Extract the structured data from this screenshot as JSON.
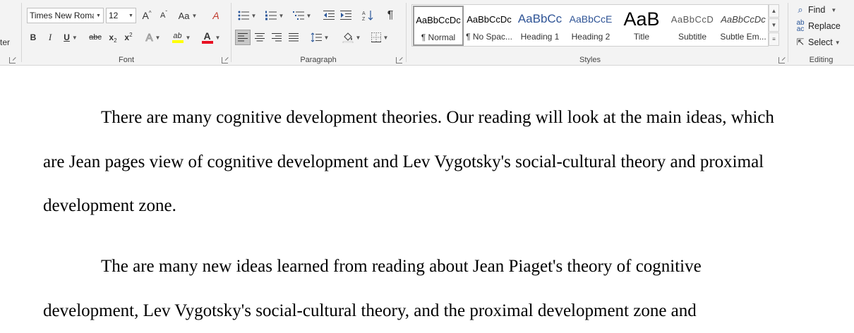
{
  "ribbon": {
    "clipboard": {
      "partial_label": "ter"
    },
    "font": {
      "label": "Font",
      "font_name": "Times New Roma",
      "font_size": "12",
      "grow_glyph": "A",
      "shrink_glyph": "A",
      "case_glyph": "Aa",
      "clear_glyph": "A",
      "bold_glyph": "B",
      "italic_glyph": "I",
      "underline_glyph": "U",
      "strike_glyph": "abc",
      "sub_glyph": "x",
      "sub_mark": "2",
      "sup_glyph": "x",
      "sup_mark": "2",
      "effects_glyph": "A",
      "highlight_glyph": "ab",
      "fontcolor_glyph": "A",
      "highlight_color": "#ffff00",
      "font_color": "#e81123"
    },
    "paragraph": {
      "label": "Paragraph",
      "pilcrow": "¶"
    },
    "styles": {
      "label": "Styles",
      "items": [
        {
          "sample": "AaBbCcDc",
          "name": "¶ Normal"
        },
        {
          "sample": "AaBbCcDc",
          "name": "¶ No Spac..."
        },
        {
          "sample": "AaBbCc",
          "name": "Heading 1"
        },
        {
          "sample": "AaBbCcE",
          "name": "Heading 2"
        },
        {
          "sample": "AaB",
          "name": "Title"
        },
        {
          "sample": "AaBbCcD",
          "name": "Subtitle"
        },
        {
          "sample": "AaBbCcDc",
          "name": "Subtle Em..."
        }
      ]
    },
    "editing": {
      "label": "Editing",
      "find": "Find",
      "replace": "Replace",
      "select": "Select"
    }
  },
  "document": {
    "paragraphs": [
      "There are many cognitive development theories. Our reading will look at the main ideas, which are Jean pages view of cognitive development and Lev Vygotsky's social-cultural theory and proximal development zone.",
      "The are many new ideas learned from reading about Jean Piaget's theory of cognitive development, Lev Vygotsky's social-cultural theory, and the proximal development zone and"
    ]
  }
}
